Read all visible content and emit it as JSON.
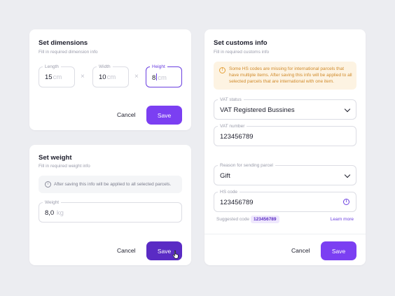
{
  "dimensions": {
    "title": "Set dimensions",
    "subtitle": "Fill in required dimension info",
    "fields": [
      {
        "label": "Length",
        "value": "15",
        "unit": "cm"
      },
      {
        "label": "Width",
        "value": "10",
        "unit": "cm"
      },
      {
        "label": "Height",
        "value": "8",
        "unit": "cm"
      }
    ],
    "separator": "×",
    "cancel_label": "Cancel",
    "save_label": "Save"
  },
  "weight": {
    "title": "Set weight",
    "subtitle": "Fill in required weight info",
    "info": "After saving this info will be applied to all selected parcels.",
    "field_label": "Weight",
    "value": "8,0",
    "unit": "kg",
    "cancel_label": "Cancel",
    "save_label": "Save"
  },
  "customs": {
    "title": "Set customs info",
    "subtitle": "Fill in required customs info",
    "warning": "Some HS codes are missing for international parcels that have multiple items. After saving this info will be applied to all selected parcels that are international with one item.",
    "vat_status_label": "VAT status",
    "vat_status_value": "VAT Registered Bussines",
    "vat_number_label": "VAT number",
    "vat_number_value": "123456789",
    "reason_label": "Reason for sending parcel",
    "reason_value": "Gift",
    "hs_label": "HS code",
    "hs_value": "123456789",
    "suggested_label": "Suggested code",
    "suggested_value": "123456789",
    "learn_more": "Learn more",
    "cancel_label": "Cancel",
    "save_label": "Save"
  },
  "colors": {
    "accent": "#7b3ff2",
    "accent_pressed": "#5a2bc4",
    "warning_bg": "#fdf3e2",
    "warning_text": "#d08a2a"
  },
  "icons": {
    "info": "info-icon",
    "warning": "warning-icon",
    "chevron": "chevron-down-icon",
    "cursor": "hand-cursor-icon"
  }
}
